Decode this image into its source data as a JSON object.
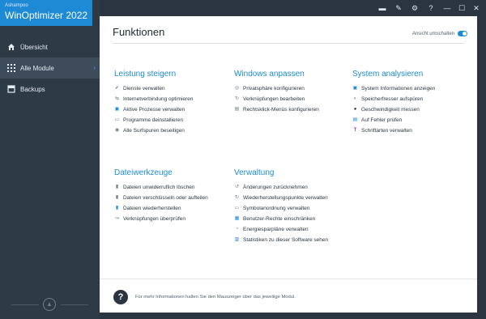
{
  "app": {
    "brand": "Ashampoo",
    "title": "WinOptimizer 2022"
  },
  "sidebar": {
    "items": [
      {
        "label": "Übersicht",
        "icon": "home-icon"
      },
      {
        "label": "Alle Module",
        "icon": "grid-icon",
        "active": true
      },
      {
        "label": "Backups",
        "icon": "backup-icon"
      }
    ]
  },
  "titlebar": {
    "icons": [
      "chat-icon",
      "edit-icon",
      "gear-icon",
      "help-icon",
      "minimize-icon",
      "maximize-icon",
      "close-icon"
    ],
    "glyphs": {
      "chat": "▬",
      "edit": "✎",
      "gear": "⚙",
      "help": "?",
      "minimize": "—",
      "maximize": "☐",
      "close": "✕"
    }
  },
  "main": {
    "title": "Funktionen",
    "toggle_label": "Ansicht umschalten",
    "groups": [
      {
        "title": "Leistung steigern",
        "items": [
          "Dienste verwalten",
          "Internetverbindung optimieren",
          "Aktive Prozesse verwalten",
          "Programme deinstallieren",
          "Alle Surfspuren beseitigen"
        ]
      },
      {
        "title": "Windows anpassen",
        "items": [
          "Privatsphäre konfigurieren",
          "Verknüpfungen bearbeiten",
          "Rechtsklick-Menüs konfigurieren"
        ]
      },
      {
        "title": "System analysieren",
        "items": [
          "System Informationen anzeigen",
          "Speicherfresser aufspüren",
          "Geschwindigkeit messen",
          "Auf Fehler prüfen",
          "Schriftarten verwalten"
        ]
      },
      {
        "title": "Dateiwerkzeuge",
        "items": [
          "Dateien unwiderruflich löschen",
          "Dateien verschlüsseln oder aufteilen",
          "Dateien wiederherstellen",
          "Verknüpfungen überprüfen"
        ]
      },
      {
        "title": "Verwaltung",
        "items": [
          "Änderungen zurücknehmen",
          "Wiederherstellungspunkte verwalten",
          "Symbolanordnung verwalten",
          "Benutzer-Rechte einschränken",
          "Energiesparpläne verwalten",
          "Statistiken zu dieser Software sehen"
        ]
      }
    ],
    "hint": "Für mehr Informationen halten Sie den Mauszeiger über das jeweilige Modul."
  },
  "colors": {
    "accent": "#1e8ad6",
    "sidebar": "#2f3a47",
    "titlebar": "#2b3541"
  }
}
